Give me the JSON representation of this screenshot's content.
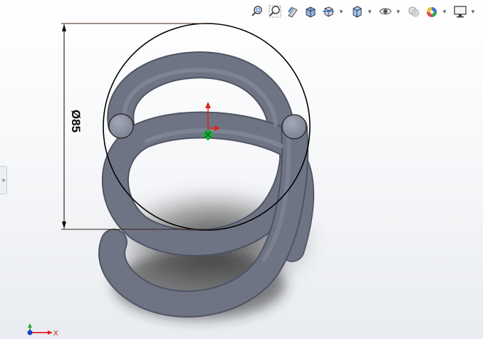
{
  "toolbar": {
    "buttons": [
      {
        "name": "zoom-to-fit-icon",
        "has_menu": false
      },
      {
        "name": "zoom-to-area-icon",
        "has_menu": false
      },
      {
        "name": "previous-view-icon",
        "has_menu": false
      },
      {
        "name": "section-view-icon",
        "has_menu": false
      },
      {
        "name": "view-orientation-icon",
        "has_menu": true
      },
      {
        "name": "display-style-icon",
        "has_menu": true
      },
      {
        "name": "hide-show-items-icon",
        "has_menu": true
      },
      {
        "name": "edit-appearance-icon",
        "has_menu": false
      },
      {
        "name": "apply-scene-icon",
        "has_menu": true
      },
      {
        "name": "view-settings-icon",
        "has_menu": true
      }
    ]
  },
  "dimension": {
    "symbol": "Ø",
    "value": "85"
  },
  "triad": {
    "x_label": "X"
  },
  "colors": {
    "part": "#6f7485",
    "part_highlight": "#9499a8",
    "sketch_line": "#000000",
    "dimension_line": "#3a2010",
    "origin_red": "#e0201c",
    "origin_green": "#20a838"
  }
}
